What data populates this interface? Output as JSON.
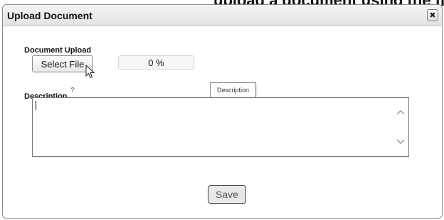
{
  "background": {
    "partial_text": "upload a document using the file upload app"
  },
  "dialog": {
    "title": "Upload Document",
    "close_icon": "✖"
  },
  "upload": {
    "label": "Document Upload",
    "select_button": "Select File",
    "progress_text": "0 %"
  },
  "description": {
    "label": "Description",
    "help_icon": "?",
    "tooltip": "Description",
    "value": ""
  },
  "footer": {
    "save_button": "Save"
  },
  "icons": {
    "close": "close-icon",
    "help": "help-icon",
    "cursor": "mouse-pointer-icon",
    "scroll_up": "chevron-up-icon",
    "scroll_down": "chevron-down-icon"
  },
  "colors": {
    "titlebar": "#e4e4e4",
    "progress_bg": "#f4f7f6",
    "border": "#8a8a8a"
  }
}
